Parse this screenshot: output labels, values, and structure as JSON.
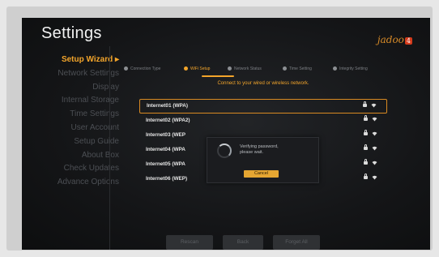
{
  "title": "Settings",
  "logo": {
    "text": "jadoo",
    "badge": "4"
  },
  "sidebar": {
    "items": [
      {
        "label": "Setup Wizard ▸",
        "active": true
      },
      {
        "label": "Network Settings",
        "active": false
      },
      {
        "label": "Display",
        "active": false
      },
      {
        "label": "Internal Storage",
        "active": false
      },
      {
        "label": "Time Settings",
        "active": false
      },
      {
        "label": "User Account",
        "active": false
      },
      {
        "label": "Setup Guide",
        "active": false
      },
      {
        "label": "About Box",
        "active": false
      },
      {
        "label": "Check Updates",
        "active": false
      },
      {
        "label": "Advance Options",
        "active": false
      }
    ]
  },
  "tabs": [
    {
      "label": "Connection Type",
      "active": false
    },
    {
      "label": "WiFi Setup",
      "active": true
    },
    {
      "label": "Network Status",
      "active": false
    },
    {
      "label": "Time Setting",
      "active": false
    },
    {
      "label": "Integrity Setting",
      "active": false
    }
  ],
  "main": {
    "headline": "Connect to your wired or wireless network.",
    "networks": [
      {
        "name": "Internet01 (WPA)",
        "selected": true
      },
      {
        "name": "Internet02 (WPA2)",
        "selected": false
      },
      {
        "name": "Internet03 (WEP",
        "selected": false
      },
      {
        "name": "Internet04 (WPA",
        "selected": false
      },
      {
        "name": "Internet05 (WPA",
        "selected": false
      },
      {
        "name": "Internet06 (WEP)",
        "selected": false
      }
    ]
  },
  "dialog": {
    "message_line1": "Verifying password,",
    "message_line2": "please wait.",
    "cancel_label": "Cancel"
  },
  "bottom": {
    "rescan_label": "Rescan",
    "back_label": "Back",
    "forget_all_label": "Forget All"
  },
  "colors": {
    "accent": "#f3a52b",
    "background": "#141517"
  }
}
